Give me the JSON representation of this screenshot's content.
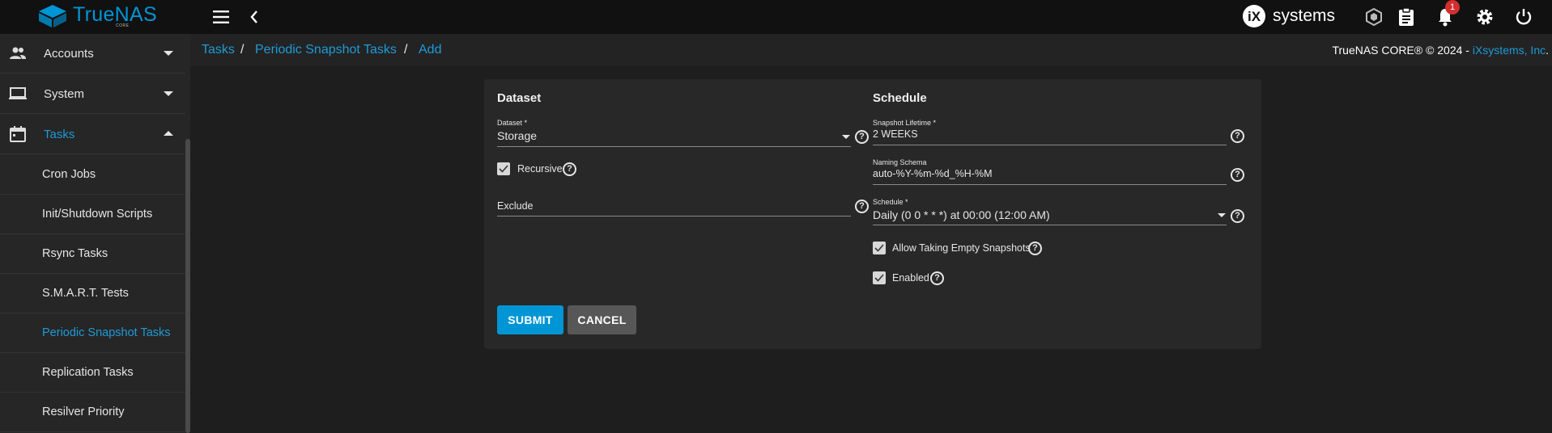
{
  "topbar": {
    "logo_text": "TrueNAS",
    "logo_sub": "CORE",
    "vendor_text": "systems",
    "notification_count": "1",
    "icons": [
      "menu-icon",
      "back-chevron-icon",
      "truecommand-icon",
      "clipboard-icon",
      "bell-icon",
      "gear-icon",
      "power-icon"
    ]
  },
  "sidebar": {
    "items": [
      {
        "label": "Accounts",
        "icon": "people-icon",
        "expanded": false
      },
      {
        "label": "System",
        "icon": "laptop-icon",
        "expanded": false
      },
      {
        "label": "Tasks",
        "icon": "calendar-icon",
        "expanded": true
      }
    ],
    "subitems": [
      {
        "label": "Cron Jobs",
        "active": false
      },
      {
        "label": "Init/Shutdown Scripts",
        "active": false
      },
      {
        "label": "Rsync Tasks",
        "active": false
      },
      {
        "label": "S.M.A.R.T. Tests",
        "active": false
      },
      {
        "label": "Periodic Snapshot Tasks",
        "active": true
      },
      {
        "label": "Replication Tasks",
        "active": false
      },
      {
        "label": "Resilver Priority",
        "active": false
      }
    ]
  },
  "breadcrumb": {
    "items": [
      "Tasks",
      "Periodic Snapshot Tasks",
      "Add"
    ],
    "separator": "/",
    "copyright_prefix": "TrueNAS CORE® © 2024 - ",
    "copyright_link": "iXsystems, Inc",
    "copyright_suffix": "."
  },
  "form": {
    "dataset_section": {
      "title": "Dataset",
      "dataset_label": "Dataset *",
      "dataset_value": "Storage",
      "recursive_label": "Recursive",
      "recursive_checked": true,
      "exclude_label": "Exclude",
      "exclude_value": ""
    },
    "schedule_section": {
      "title": "Schedule",
      "lifetime_label": "Snapshot Lifetime *",
      "lifetime_value": "2 WEEKS",
      "naming_label": "Naming Schema",
      "naming_value": "auto-%Y-%m-%d_%H-%M",
      "schedule_label": "Schedule *",
      "schedule_value": "Daily (0 0 * * *) at 00:00 (12:00 AM)",
      "empty_snapshots_label": "Allow Taking Empty Snapshots",
      "empty_snapshots_checked": true,
      "enabled_label": "Enabled",
      "enabled_checked": true
    },
    "buttons": {
      "submit": "SUBMIT",
      "cancel": "CANCEL"
    },
    "help_glyph": "?"
  },
  "colors": {
    "accent": "#0095d5",
    "link": "#1e9bd7",
    "background": "#1e1e1e",
    "card": "#282828",
    "topbar": "#111111"
  }
}
